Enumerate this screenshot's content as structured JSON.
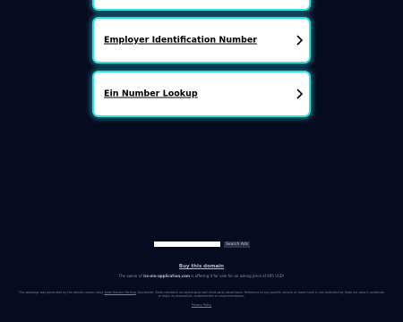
{
  "links": [
    {
      "label": ""
    },
    {
      "label": "Employer Identification Number"
    },
    {
      "label": "Ein Number Lookup"
    }
  ],
  "search": {
    "value": "",
    "button_label": "Search Ads"
  },
  "footer": {
    "buy_label": "Buy this domain",
    "owner_prefix": "The owner of ",
    "owner_domain": "irs-ein-application.com",
    "owner_suffix": " is offering it for sale for an asking price of 695 USD!",
    "disclaimer_prefix": "This webpage was generated by the domain owner using ",
    "disclaimer_link": "Sedo Domain Parking",
    "disclaimer_suffix": ". Disclaimer: Sedo maintains no relationship with third party advertisers. Reference to any specific service or trade mark is not controlled by Sedo nor does it constitute or imply its association, endorsement or recommendation.",
    "privacy_label": "Privacy Policy"
  },
  "colors": {
    "background": "#060b1f",
    "card_border": "#27e3e8",
    "card_bg": "#ffffff"
  },
  "icons": {
    "link_arrow": "chevron-right-icon"
  }
}
